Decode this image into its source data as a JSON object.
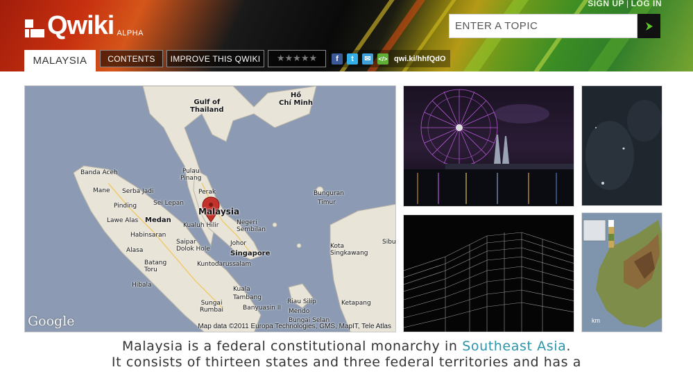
{
  "header": {
    "logo_text": "Qwiki",
    "logo_badge": "ALPHA",
    "auth": {
      "signup": "SIGN UP",
      "separator": "|",
      "login": "LOG IN"
    },
    "search": {
      "placeholder": "ENTER A TOPIC",
      "value": "",
      "submit_icon": "arrow-right-icon"
    }
  },
  "tabs": {
    "active": "MALAYSIA",
    "contents": "CONTENTS",
    "improve": "IMPROVE THIS QWIKI",
    "rating_stars": "★★★★★",
    "share_icons": [
      "facebook-icon",
      "twitter-icon",
      "email-icon",
      "embed-icon"
    ],
    "short_link": "qwi.ki/hhfQdO"
  },
  "map": {
    "labels": {
      "gulf": "Gulf of\nThailand",
      "hcmc": "Hồ\nChí Minh",
      "banda_aceh": "Banda Aceh",
      "mane": "Mane",
      "serba_jadi": "Serba Jadi",
      "pinding": "Pinding",
      "sei_lepan": "Sei Lepan",
      "lawe_alas": "Lawe Alas",
      "medan": "Medan",
      "pulau_pinang": "Pulau\nPinang",
      "perak": "Perak",
      "malaysia": "Malaysia",
      "kualuh_hilir": "Kualuh Hilir",
      "negeri_sembilan": "Negeri\nSembilan",
      "habinsaran": "Habinsaran",
      "saipar_dolok_hole": "Saipar\nDolok Hole",
      "johor": "Johor",
      "singapore": "Singapore",
      "alasa": "Alasa",
      "batang_toru": "Batang\nToru",
      "kuntodarussalam": "Kuntodarussalam",
      "hibala": "Hibala",
      "kuala": "Kuala",
      "tambang": "Tambang",
      "sungai_rumbai": "Sungai\nRumbai",
      "banyuasin": "Banyuasin II",
      "riau_silip": "Riau Silip",
      "mendo": "Mendo",
      "bungai_selan": "Bungai Selan",
      "bunguran": "Bunguran",
      "timur": "Timur",
      "kota_singkawang": "Kota\nSingkawang",
      "sibu": "Sibu",
      "ketapang": "Ketapang"
    },
    "google": "Google",
    "attribution": "Map data ©2011 Europa Technologies, GMS, MapIT, Tele Atlas"
  },
  "thumbs": {
    "inset_legend_unit": "km"
  },
  "caption": {
    "line1_pre": "Malaysia is a federal constitutional monarchy in ",
    "line1_link": "Southeast Asia",
    "line1_post": ".",
    "line2": "It consists of thirteen states and three federal territories and has a"
  }
}
